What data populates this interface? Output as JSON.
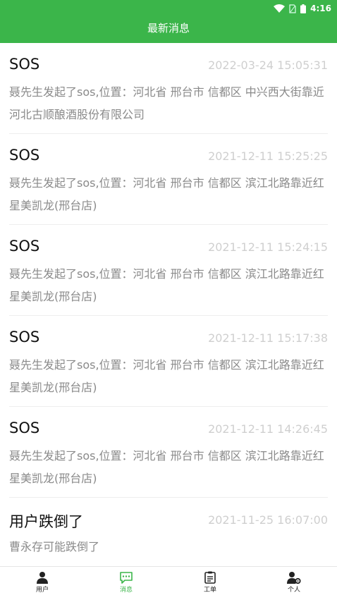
{
  "status_bar": {
    "time": "4:16"
  },
  "header": {
    "title": "最新消息"
  },
  "messages": [
    {
      "title": "SOS",
      "time": "2022-03-24 15:05:31",
      "body": "聂先生发起了sos,位置：河北省 邢台市 信都区 中兴西大街靠近河北古顺酿酒股份有限公司"
    },
    {
      "title": "SOS",
      "time": "2021-12-11 15:25:25",
      "body": "聂先生发起了sos,位置：河北省 邢台市 信都区 滨江北路靠近红星美凯龙(邢台店)"
    },
    {
      "title": "SOS",
      "time": "2021-12-11 15:24:15",
      "body": "聂先生发起了sos,位置：河北省 邢台市 信都区 滨江北路靠近红星美凯龙(邢台店)"
    },
    {
      "title": "SOS",
      "time": "2021-12-11 15:17:38",
      "body": "聂先生发起了sos,位置：河北省 邢台市 信都区 滨江北路靠近红星美凯龙(邢台店)"
    },
    {
      "title": "SOS",
      "time": "2021-12-11 14:26:45",
      "body": "聂先生发起了sos,位置：河北省 邢台市 信都区 滨江北路靠近红星美凯龙(邢台店)"
    },
    {
      "title": "用户跌倒了",
      "time": "2021-11-25 16:07:00",
      "body": "曹永存可能跌倒了"
    }
  ],
  "tabs": [
    {
      "label": "用户",
      "icon": "user-icon"
    },
    {
      "label": "消息",
      "icon": "message-icon",
      "active": true
    },
    {
      "label": "工单",
      "icon": "work-order-icon"
    },
    {
      "label": "个人",
      "icon": "user-settings-icon"
    }
  ],
  "colors": {
    "accent": "#3bb54a",
    "time_text": "#cfcfcf",
    "body_text": "#8a8a8a"
  }
}
